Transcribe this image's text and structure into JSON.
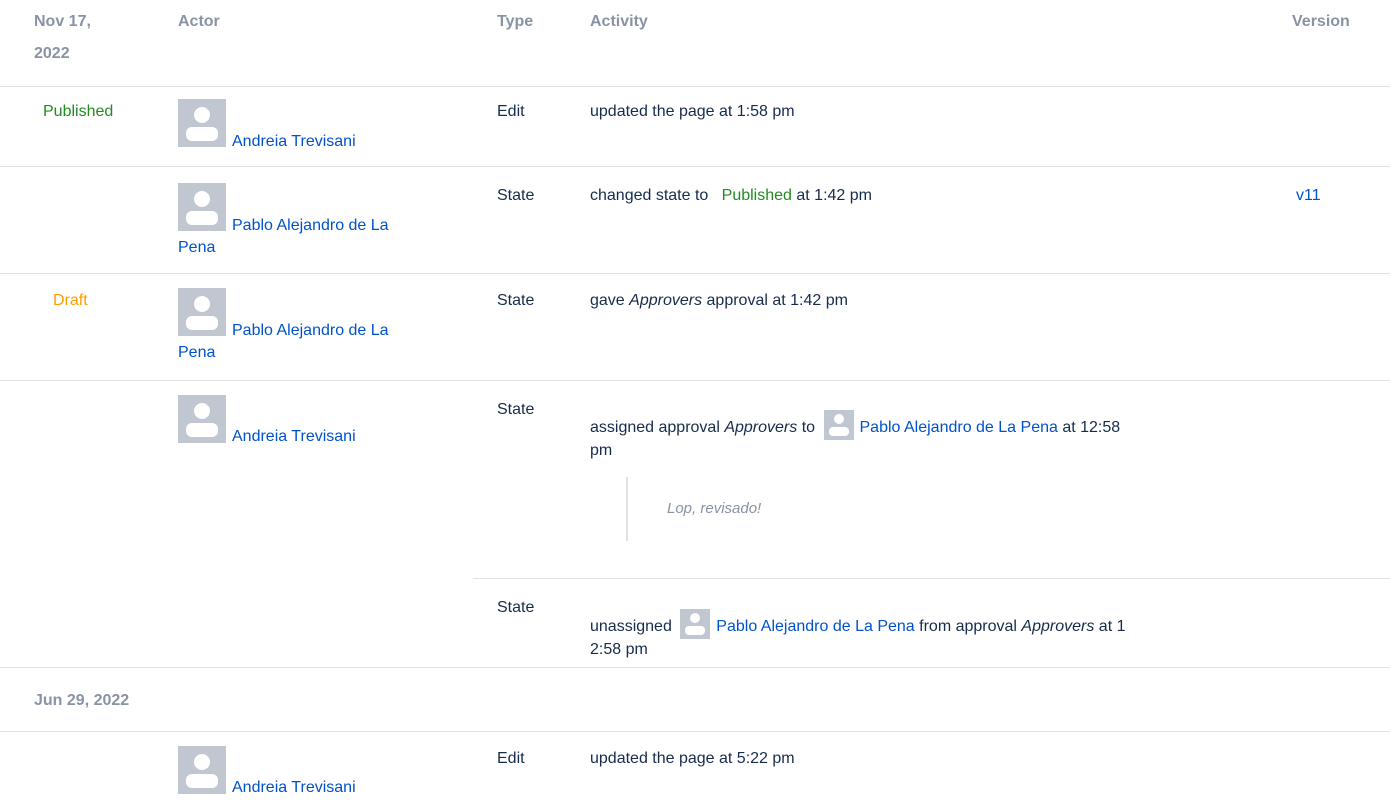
{
  "header": {
    "date_line1": "Nov 17,",
    "date_line2": "2022",
    "actor": "Actor",
    "type": "Type",
    "activity": "Activity",
    "version": "Version"
  },
  "rows": [
    {
      "state": "Published",
      "actor": "Andreia Trevisani",
      "type": "Edit",
      "activity": "updated the page at 1:58 pm"
    },
    {
      "actor_line1": "Pablo Alejandro de La",
      "actor_line2": "Pena",
      "type": "State",
      "activity_prefix": "changed state to",
      "activity_state": "Published",
      "activity_suffix": "at 1:42 pm",
      "version": "v11"
    },
    {
      "state": "Draft",
      "actor_line1": "Pablo Alejandro de La",
      "actor_line2": "Pena",
      "type": "State",
      "activity_prefix": "gave",
      "activity_group": "Approvers",
      "activity_suffix": "approval at 1:42 pm"
    },
    {
      "actor": "Andreia Trevisani",
      "type": "State",
      "activity_prefix": "assigned approval",
      "activity_group": "Approvers",
      "activity_to": "to",
      "activity_user": "Pablo Alejandro de La Pena",
      "activity_suffix": "at 12:58",
      "activity_line2": "pm",
      "comment": "Lop, revisado!"
    },
    {
      "type": "State",
      "activity_prefix": "unassigned",
      "activity_user": "Pablo Alejandro de La Pena",
      "activity_mid": "from approval",
      "activity_group": "Approvers",
      "activity_suffix": "at 1",
      "activity_line2": "2:58 pm"
    }
  ],
  "section2": {
    "date": "Jun 29, 2022",
    "row": {
      "actor": "Andreia Trevisani",
      "type": "Edit",
      "activity": "updated the page at 5:22 pm"
    }
  },
  "colors": {
    "link": "#0052cc",
    "published": "#228b22",
    "draft": "#ff9d00",
    "header": "#8993a4",
    "separator": "#dfe1e6",
    "avatar": "#c1c7d0"
  },
  "icons": {
    "avatar": "user-avatar-icon"
  }
}
